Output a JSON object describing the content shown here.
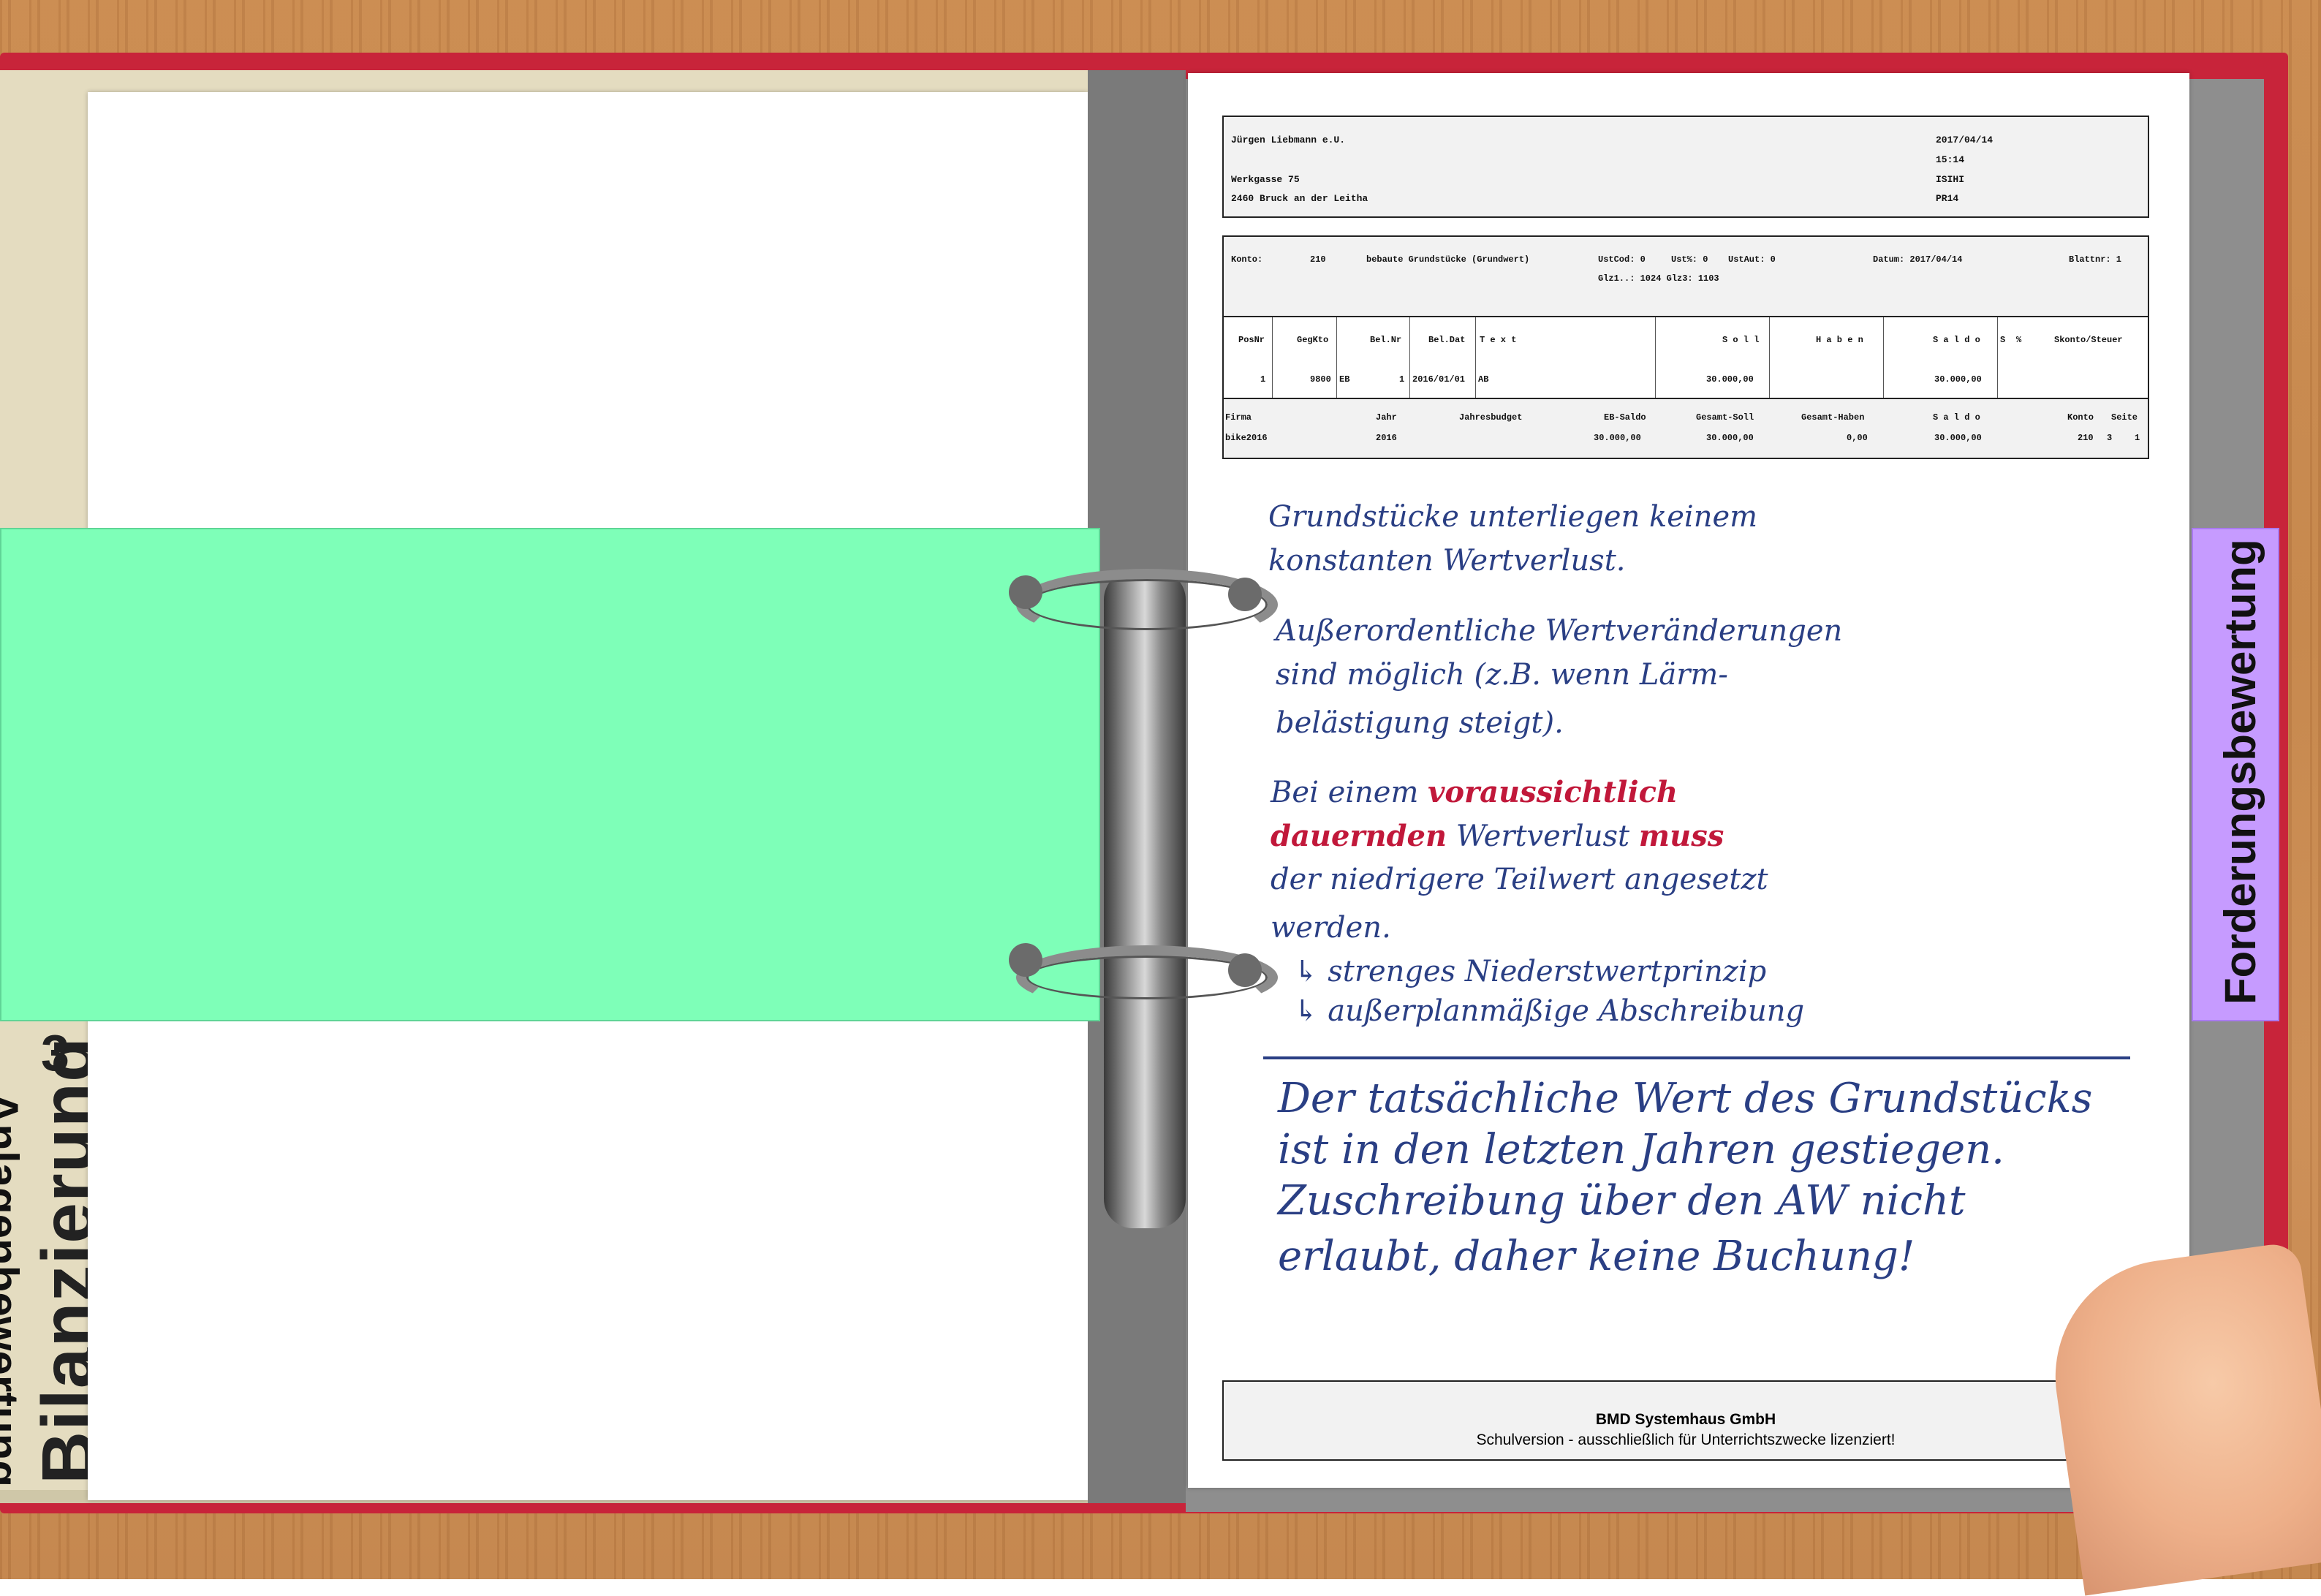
{
  "binder": {
    "spine_label": "Bilanzierung",
    "spine_number": "3",
    "left_tab": "Anlagenbewertung",
    "right_tab": "Forderungsbewertung"
  },
  "report": {
    "company": "Jürgen Liebmann e.U.",
    "street": "Werkgasse 75",
    "city": "2460 Bruck an der Leitha",
    "date": "2017/04/14",
    "time": "15:14",
    "code1": "ISIHI",
    "code2": "PR14",
    "konto_label": "Konto:",
    "konto_nr": "210",
    "konto_name": "bebaute Grundstücke (Grundwert)",
    "ustcod": "UstCod:  0",
    "ustp": "Ust%:  0",
    "ustaut": "UstAut: 0",
    "datum": "Datum: 2017/04/14",
    "blattnr": "Blattnr:    1",
    "glz": "Glz1..: 1024  Glz3: 1103",
    "columns": [
      "PosNr",
      "GegKto",
      "Bel.Nr",
      "Bel.Dat",
      "T e x t",
      "S o l l",
      "H a b e n",
      "S a l d o",
      "S",
      "%",
      "Skonto/Steuer"
    ],
    "row": {
      "posnr": "1",
      "gegkto": "9800",
      "eb": "EB",
      "belnr": "1",
      "beldat": "2016/01/01",
      "text": "AB",
      "soll": "30.000,00",
      "haben": "",
      "saldo": "30.000,00"
    },
    "footer_cols": [
      "Firma",
      "Jahr",
      "Jahresbudget",
      "EB-Saldo",
      "Gesamt-Soll",
      "Gesamt-Haben",
      "S a l d o",
      "Konto",
      "Seite"
    ],
    "footer_vals": {
      "firma": "bike2016",
      "jahr": "2016",
      "eb_saldo": "30.000,00",
      "gesamt_soll": "30.000,00",
      "gesamt_haben": "0,00",
      "saldo": "30.000,00",
      "konto": "210",
      "s": "3",
      "seite": "1"
    },
    "footer_company": "BMD Systemhaus GmbH",
    "footer_note": "Schulversion - ausschließlich für Unterrichtszwecke lizenziert!"
  },
  "notes": {
    "p1_l1": "Grundstücke unterliegen keinem",
    "p1_l2": "konstanten Wertverlust.",
    "p2_l1": "Außerordentliche Wertveränderungen",
    "p2_l2": "sind möglich (z.B. wenn Lärm-",
    "p2_l3": "belästigung steigt).",
    "p3_a": "Bei einem ",
    "p3_red1": "voraussichtlich",
    "p3_red2": "dauernden",
    "p3_b": " Wertverlust ",
    "p3_red3": "muss",
    "p3_l3": "der niedrigere Teilwert angesetzt",
    "p3_l4": "werden.",
    "b1": "↳ strenges Niederstwertprinzip",
    "b2": "↳ außerplanmäßige Abschreibung",
    "c1": "Der tatsächliche Wert des Grundstücks",
    "c2": "ist in den letzten Jahren gestiegen.",
    "c3": "Zuschreibung über den AW nicht",
    "c4": "erlaubt, daher keine Buchung!"
  }
}
